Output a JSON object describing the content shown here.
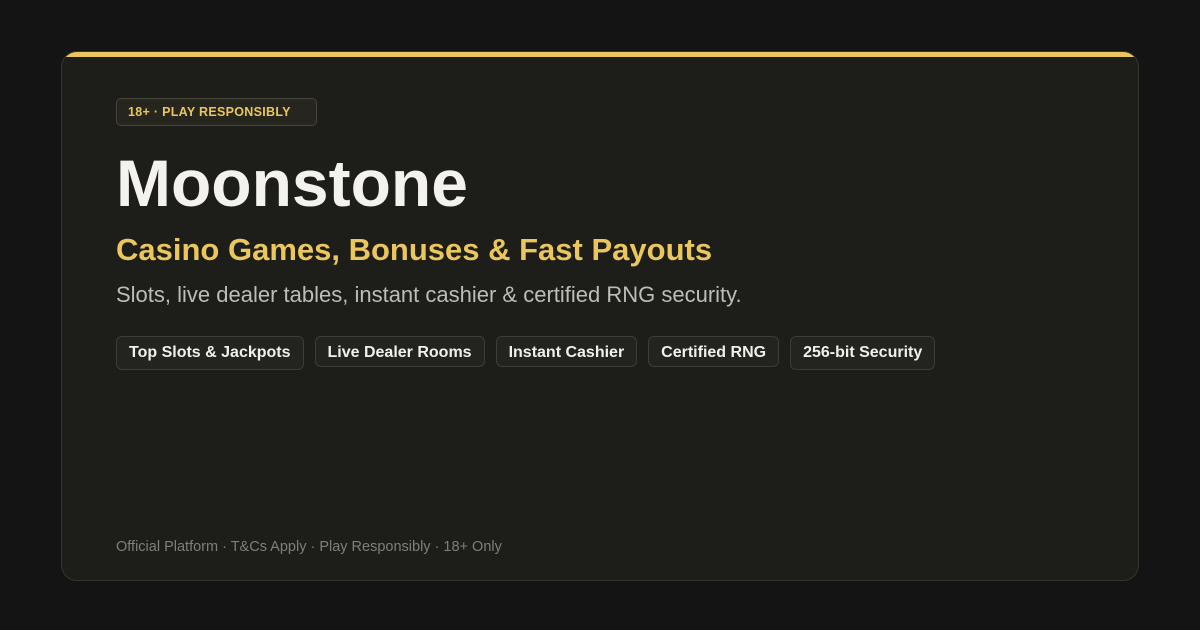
{
  "badge": {
    "text": "18+ · PLAY RESPONSIBLY"
  },
  "hero": {
    "title": "Moonstone",
    "subtitle": "Casino Games, Bonuses & Fast Payouts",
    "description": "Slots, live dealer tables, instant cashier & certified RNG security."
  },
  "tags": [
    {
      "label": "Top Slots & Jackpots"
    },
    {
      "label": "Live Dealer Rooms"
    },
    {
      "label": "Instant Cashier"
    },
    {
      "label": "Certified RNG"
    },
    {
      "label": "256-bit Security"
    }
  ],
  "footer": {
    "text": "Official Platform · T&Cs Apply · Play Responsibly · 18+ Only"
  },
  "colors": {
    "accent": "#ebc65c",
    "background": "#141414",
    "card": "#1d1d1a"
  }
}
